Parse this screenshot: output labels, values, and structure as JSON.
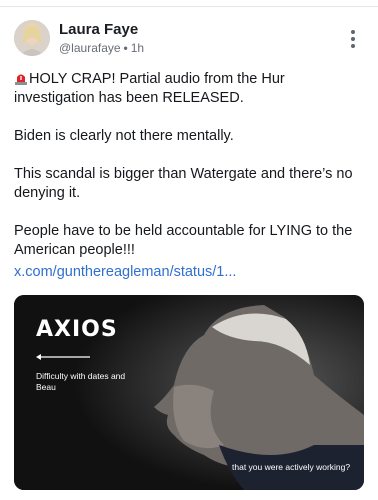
{
  "author": {
    "name": "Laura Faye",
    "handle": "@laurafaye",
    "time": "1h",
    "separator": "•"
  },
  "post": {
    "emoji": "siren-icon",
    "paragraphs": [
      "HOLY CRAP! Partial audio from the Hur investigation has been RELEASED.",
      "Biden is clearly not there mentally.",
      "This scandal is bigger than Watergate and there’s no denying it.",
      "People have to be held accountable for LYING to the American people!!!"
    ],
    "link": "x.com/gunthereagleman/status/1..."
  },
  "media": {
    "brand": "AXIOS",
    "caption": "Difficulty with dates and Beau",
    "subtitle": "that you were actively working?"
  },
  "colors": {
    "link": "#2f6fd0",
    "text": "#15181c",
    "meta": "#676d75",
    "siren_red": "#e0242b"
  }
}
